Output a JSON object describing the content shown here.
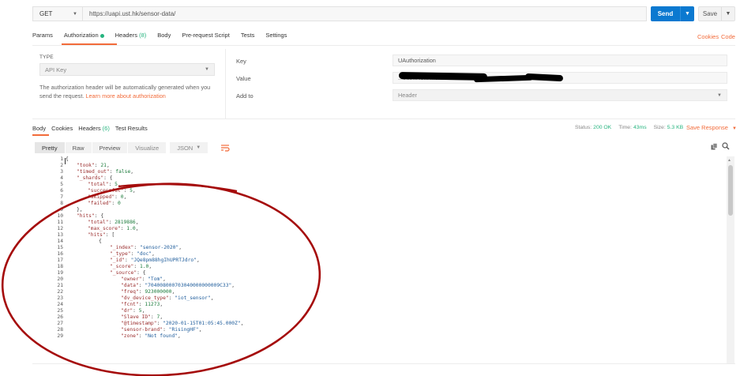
{
  "request": {
    "method": "GET",
    "url": "https://uapi.ust.hk/sensor-data/",
    "send_label": "Send",
    "save_label": "Save"
  },
  "request_tabs": [
    {
      "label": "Params"
    },
    {
      "label": "Authorization"
    },
    {
      "label": "Headers",
      "count": "(8)"
    },
    {
      "label": "Body"
    },
    {
      "label": "Pre-request Script"
    },
    {
      "label": "Tests"
    },
    {
      "label": "Settings"
    }
  ],
  "links": {
    "cookies": "Cookies",
    "code": "Code"
  },
  "auth": {
    "type_label": "TYPE",
    "type_value": "API Key",
    "help_text": "The authorization header will be automatically generated when you send the request. ",
    "help_link": "Learn more about authorization",
    "key_label": "Key",
    "key_value": "UAuthorization",
    "value_label": "Value",
    "value_visible": "...ba5...4e...  ...3f1b...5b1c596...  ...b...",
    "addto_label": "Add to",
    "addto_value": "Header"
  },
  "response_tabs": [
    {
      "label": "Body"
    },
    {
      "label": "Cookies"
    },
    {
      "label": "Headers",
      "count": "(6)"
    },
    {
      "label": "Test Results"
    }
  ],
  "response_meta": {
    "status_label": "Status:",
    "status_value": "200 OK",
    "time_label": "Time:",
    "time_value": "43ms",
    "size_label": "Size:",
    "size_value": "5.3 KB",
    "save_response": "Save Response"
  },
  "format_buttons": {
    "pretty": "Pretty",
    "raw": "Raw",
    "preview": "Preview",
    "visualize": "Visualize",
    "json": "JSON"
  },
  "icons": {
    "copy": "copy-icon",
    "search": "search-icon",
    "wrap": "wrap-icon"
  },
  "colors": {
    "accent": "#f26b3a",
    "send": "#0b79d0",
    "success": "#26b47f"
  },
  "code_lines": [
    {
      "i": 0,
      "t": [
        [
          "p",
          "{"
        ]
      ]
    },
    {
      "i": 1,
      "t": [
        [
          "k",
          "\"took\""
        ],
        [
          "p",
          ": "
        ],
        [
          "n",
          "21"
        ],
        [
          "p",
          ","
        ]
      ]
    },
    {
      "i": 1,
      "t": [
        [
          "k",
          "\"timed_out\""
        ],
        [
          "p",
          ": "
        ],
        [
          "n",
          "false"
        ],
        [
          "p",
          ","
        ]
      ]
    },
    {
      "i": 1,
      "t": [
        [
          "k",
          "\"_shards\""
        ],
        [
          "p",
          ": {"
        ]
      ]
    },
    {
      "i": 2,
      "t": [
        [
          "k",
          "\"total\""
        ],
        [
          "p",
          ": "
        ],
        [
          "n",
          "5"
        ],
        [
          "p",
          ","
        ]
      ]
    },
    {
      "i": 2,
      "t": [
        [
          "k",
          "\"successful\""
        ],
        [
          "p",
          ": "
        ],
        [
          "n",
          "5"
        ],
        [
          "p",
          ","
        ]
      ]
    },
    {
      "i": 2,
      "t": [
        [
          "k",
          "\"skipped\""
        ],
        [
          "p",
          ": "
        ],
        [
          "n",
          "0"
        ],
        [
          "p",
          ","
        ]
      ]
    },
    {
      "i": 2,
      "t": [
        [
          "k",
          "\"failed\""
        ],
        [
          "p",
          ": "
        ],
        [
          "n",
          "0"
        ]
      ]
    },
    {
      "i": 1,
      "t": [
        [
          "p",
          "},"
        ]
      ]
    },
    {
      "i": 1,
      "t": [
        [
          "k",
          "\"hits\""
        ],
        [
          "p",
          ": {"
        ]
      ]
    },
    {
      "i": 2,
      "t": [
        [
          "k",
          "\"total\""
        ],
        [
          "p",
          ": "
        ],
        [
          "n",
          "2819886"
        ],
        [
          "p",
          ","
        ]
      ]
    },
    {
      "i": 2,
      "t": [
        [
          "k",
          "\"max_score\""
        ],
        [
          "p",
          ": "
        ],
        [
          "n",
          "1.0"
        ],
        [
          "p",
          ","
        ]
      ]
    },
    {
      "i": 2,
      "t": [
        [
          "k",
          "\"hits\""
        ],
        [
          "p",
          ": ["
        ]
      ]
    },
    {
      "i": 3,
      "t": [
        [
          "p",
          "{"
        ]
      ]
    },
    {
      "i": 4,
      "t": [
        [
          "k",
          "\"_index\""
        ],
        [
          "p",
          ": "
        ],
        [
          "s",
          "\"sensor-2020\""
        ],
        [
          "p",
          ","
        ]
      ]
    },
    {
      "i": 4,
      "t": [
        [
          "k",
          "\"_type\""
        ],
        [
          "p",
          ": "
        ],
        [
          "s",
          "\"doc\""
        ],
        [
          "p",
          ","
        ]
      ]
    },
    {
      "i": 4,
      "t": [
        [
          "k",
          "\"_id\""
        ],
        [
          "p",
          ": "
        ],
        [
          "s",
          "\"JQe8pm88hgIhUPRTJdro\""
        ],
        [
          "p",
          ","
        ]
      ]
    },
    {
      "i": 4,
      "t": [
        [
          "k",
          "\"_score\""
        ],
        [
          "p",
          ": "
        ],
        [
          "n",
          "1.0"
        ],
        [
          "p",
          ","
        ]
      ]
    },
    {
      "i": 4,
      "t": [
        [
          "k",
          "\"_source\""
        ],
        [
          "p",
          ": {"
        ]
      ]
    },
    {
      "i": 5,
      "t": [
        [
          "k",
          "\"owner\""
        ],
        [
          "p",
          ": "
        ],
        [
          "s",
          "\"Tom\""
        ],
        [
          "p",
          ","
        ]
      ]
    },
    {
      "i": 5,
      "t": [
        [
          "k",
          "\"data\""
        ],
        [
          "p",
          ": "
        ],
        [
          "s",
          "\"704008000703040000000009C33\""
        ],
        [
          "p",
          ","
        ]
      ]
    },
    {
      "i": 5,
      "t": [
        [
          "k",
          "\"freq\""
        ],
        [
          "p",
          ": "
        ],
        [
          "n",
          "923000000"
        ],
        [
          "p",
          ","
        ]
      ]
    },
    {
      "i": 5,
      "t": [
        [
          "k",
          "\"dv_device_type\""
        ],
        [
          "p",
          ": "
        ],
        [
          "s",
          "\"iot_sensor\""
        ],
        [
          "p",
          ","
        ]
      ]
    },
    {
      "i": 5,
      "t": [
        [
          "k",
          "\"fcnt\""
        ],
        [
          "p",
          ": "
        ],
        [
          "n",
          "11273"
        ],
        [
          "p",
          ","
        ]
      ]
    },
    {
      "i": 5,
      "t": [
        [
          "k",
          "\"dr\""
        ],
        [
          "p",
          ": "
        ],
        [
          "n",
          "5"
        ],
        [
          "p",
          ","
        ]
      ]
    },
    {
      "i": 5,
      "t": [
        [
          "k",
          "\"Slave ID\""
        ],
        [
          "p",
          ": "
        ],
        [
          "n",
          "7"
        ],
        [
          "p",
          ","
        ]
      ]
    },
    {
      "i": 5,
      "t": [
        [
          "k",
          "\"@timestamp\""
        ],
        [
          "p",
          ": "
        ],
        [
          "s",
          "\"2020-01-15T01:05:45.000Z\""
        ],
        [
          "p",
          ","
        ]
      ]
    },
    {
      "i": 5,
      "t": [
        [
          "k",
          "\"sensor-brand\""
        ],
        [
          "p",
          ": "
        ],
        [
          "s",
          "\"RisingHF\""
        ],
        [
          "p",
          ","
        ]
      ]
    },
    {
      "i": 5,
      "t": [
        [
          "k",
          "\"zone\""
        ],
        [
          "p",
          ": "
        ],
        [
          "s",
          "\"Not found\""
        ],
        [
          "p",
          ","
        ]
      ]
    }
  ]
}
